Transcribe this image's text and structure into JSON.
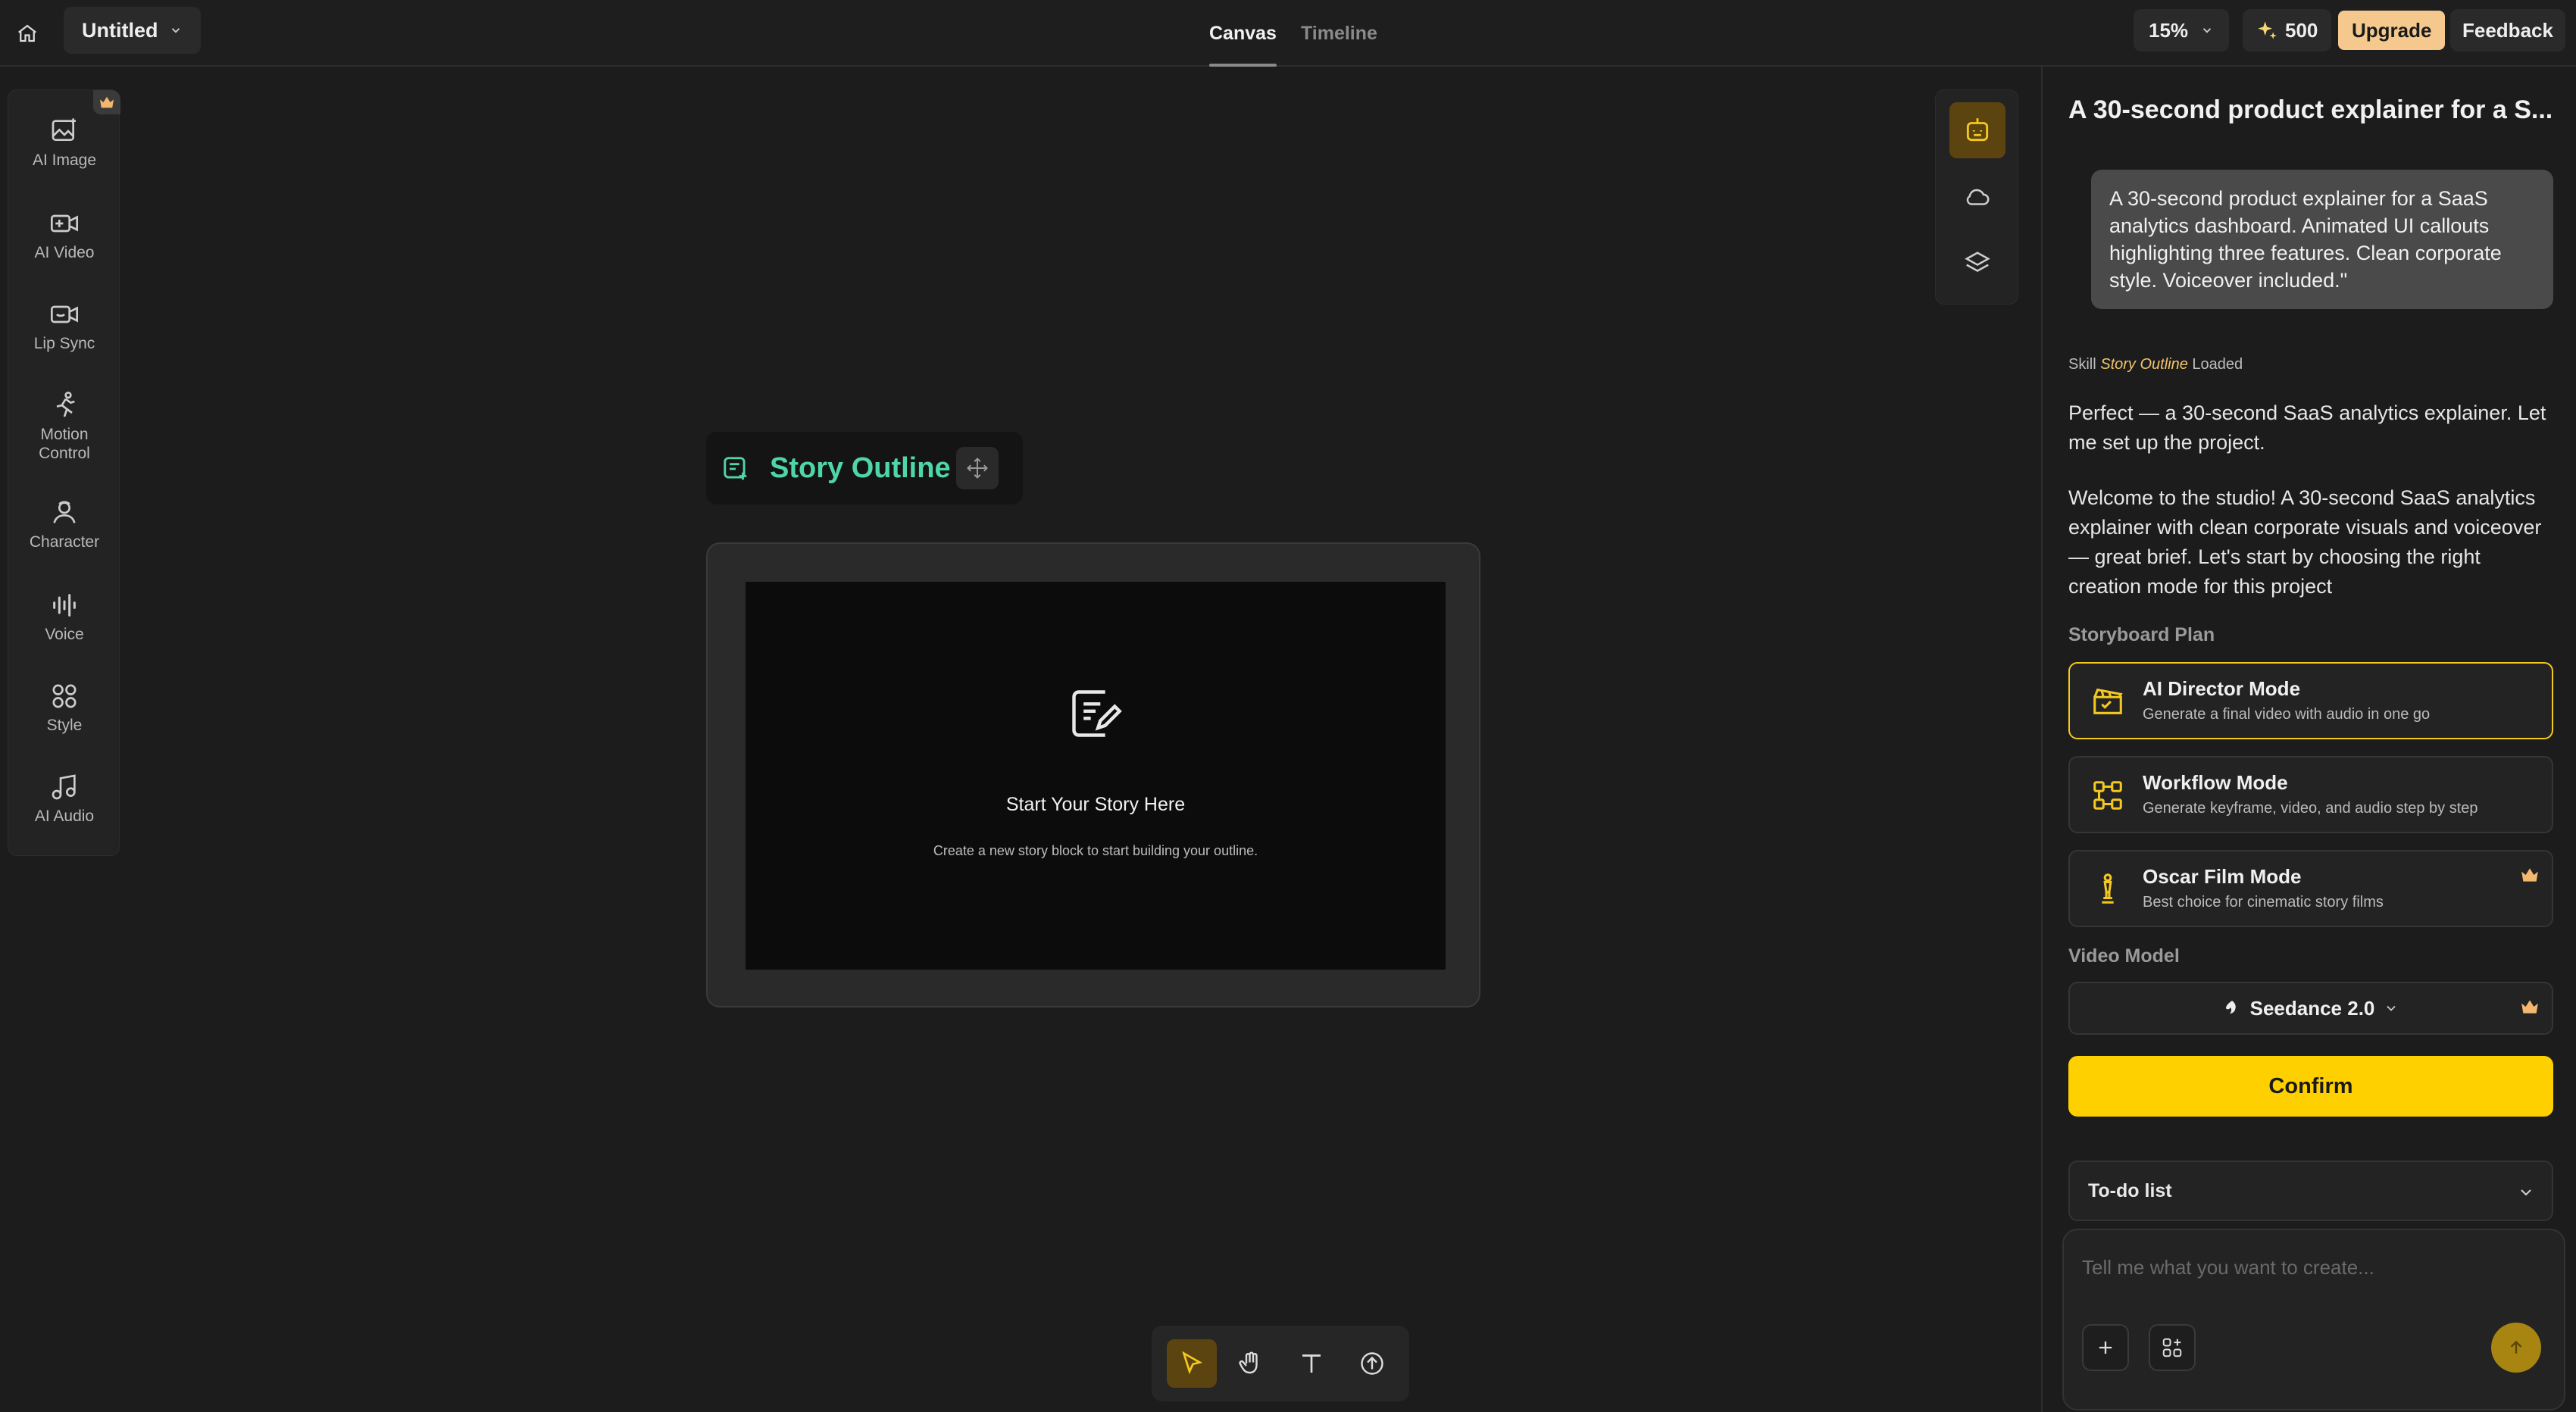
{
  "topbar": {
    "project_name": "Untitled",
    "tabs": [
      {
        "label": "Canvas",
        "active": true
      },
      {
        "label": "Timeline",
        "active": false
      }
    ],
    "zoom": "15%",
    "credits": "500",
    "upgrade_label": "Upgrade",
    "feedback_label": "Feedback"
  },
  "left_toolbar": {
    "items": [
      {
        "label": "AI Image",
        "icon": "image-sparkle-icon",
        "premium": true
      },
      {
        "label": "AI Video",
        "icon": "video-sparkle-icon"
      },
      {
        "label": "Lip Sync",
        "icon": "lip-sync-icon"
      },
      {
        "label": "Motion Control",
        "icon": "running-person-icon"
      },
      {
        "label": "Character",
        "icon": "character-icon"
      },
      {
        "label": "Voice",
        "icon": "waveform-icon"
      },
      {
        "label": "Style",
        "icon": "style-icon"
      },
      {
        "label": "AI Audio",
        "icon": "music-note-icon"
      }
    ]
  },
  "right_tools": [
    "agent-icon",
    "cloud-icon",
    "layers-icon"
  ],
  "canvas": {
    "outline_title": "Story Outline",
    "empty_title": "Start Your Story Here",
    "empty_subtitle": "Create a new story block to start building your outline."
  },
  "bottom_tools": [
    "pointer-icon",
    "hand-icon",
    "text-icon",
    "upload-icon"
  ],
  "panel": {
    "title": "A 30-second product explainer for a S...",
    "user_message": "A 30-second product explainer for a SaaS analytics dashboard. Animated UI callouts highlighting three features. Clean corporate style. Voiceover included.\"",
    "skill_prefix": "Skill",
    "skill_name": "Story Outline",
    "skill_suffix": "Loaded",
    "reply_1": "Perfect — a 30-second SaaS analytics explainer. Let me set up the project.",
    "reply_2": "Welcome to the studio! A 30-second SaaS analytics explainer with clean corporate visuals and voiceover — great brief. Let's start by choosing the right creation mode for this project",
    "storyboard_label": "Storyboard Plan",
    "modes": [
      {
        "title": "AI Director Mode",
        "subtitle": "Generate a final video with audio in one go",
        "selected": true
      },
      {
        "title": "Workflow Mode",
        "subtitle": "Generate keyframe, video, and audio step by step",
        "selected": false
      },
      {
        "title": "Oscar Film Mode",
        "subtitle": "Best choice for cinematic story films",
        "selected": false,
        "premium": true
      }
    ],
    "video_model_label": "Video Model",
    "video_model_value": "Seedance 2.0",
    "confirm_label": "Confirm",
    "todo_label": "To-do list",
    "input_placeholder": "Tell me what you want to create..."
  },
  "colors": {
    "accent": "#ffd000",
    "selected_border": "#f4c91f",
    "outline_green": "#4fd6a8",
    "upgrade_bg": "#f5c98d"
  }
}
